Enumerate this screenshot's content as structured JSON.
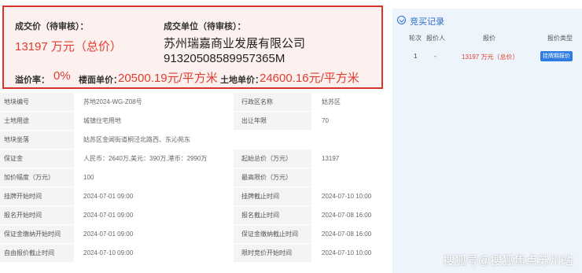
{
  "deal": {
    "price_label": "成交价（待审核）：",
    "price_value": "13197 万元（总价）",
    "company_label": "成交单位（待审核）：",
    "company_name": "苏州瑞嘉商业发展有限公司",
    "company_code": "91320508589957365M",
    "premium_label": "溢价率：",
    "premium_value": "0%",
    "floor_price_label": "楼面单价：",
    "floor_price_value": "20500.19元/平方米",
    "land_price_label": "土地单价：",
    "land_price_value": "24600.16元/平方米"
  },
  "info": {
    "r1": {
      "l1": "地块编号",
      "v1": "苏地2024-WG-Z08号",
      "l2": "行政区名称",
      "v2": "姑苏区"
    },
    "r2": {
      "l1": "土地用途",
      "v1": "城镇住宅用地",
      "l2": "出让年限",
      "v2": "70"
    },
    "r3": {
      "l1": "地块坐落",
      "v1": "姑苏区金阊街道桐泾北路西、东沁苑东"
    },
    "r4": {
      "l1": "保证金",
      "v1": "人民币：2640万,美元：390万,港币：2990万",
      "l2": "起始总价（万元）",
      "v2": "13197"
    },
    "r5": {
      "l1": "加价幅度（万元）",
      "v1": "100",
      "l2": "最高限价（万元）",
      "v2": ""
    },
    "r6": {
      "l1": "挂牌开始时间",
      "v1": "2024-07-01 09:00",
      "l2": "挂牌截止时间",
      "v2": "2024-07-10 10:00"
    },
    "r7": {
      "l1": "报名开始时间",
      "v1": "2024-07-01 09:00",
      "l2": "报名截止时间",
      "v2": "2024-07-08 16:00"
    },
    "r8": {
      "l1": "保证金缴纳开始时间",
      "v1": "2024-07-01 09:00",
      "l2": "保证金缴纳截止时间",
      "v2": "2024-07-08 16:00"
    },
    "r9": {
      "l1": "自由报价截止时间",
      "v1": "2024-07-10 09:00",
      "l2": "限时竞价开始时间",
      "v2": "2024-07-10 10:00"
    }
  },
  "bids": {
    "title": "竞买记录",
    "headers": {
      "round": "轮次",
      "bidder": "报价人",
      "price": "报价",
      "type": "报价类型"
    },
    "rows": [
      {
        "round": "1",
        "bidder": "-",
        "price": "13197 万元（总价）",
        "type": "挂牌期报价"
      }
    ]
  },
  "watermark": "搜狐号@搜狐焦点苏州站",
  "colors": {
    "accent_red": "#e03c2f",
    "border_red": "#d9332b",
    "accent_blue": "#2a6ccf",
    "panel_bg": "#eef4fb"
  }
}
